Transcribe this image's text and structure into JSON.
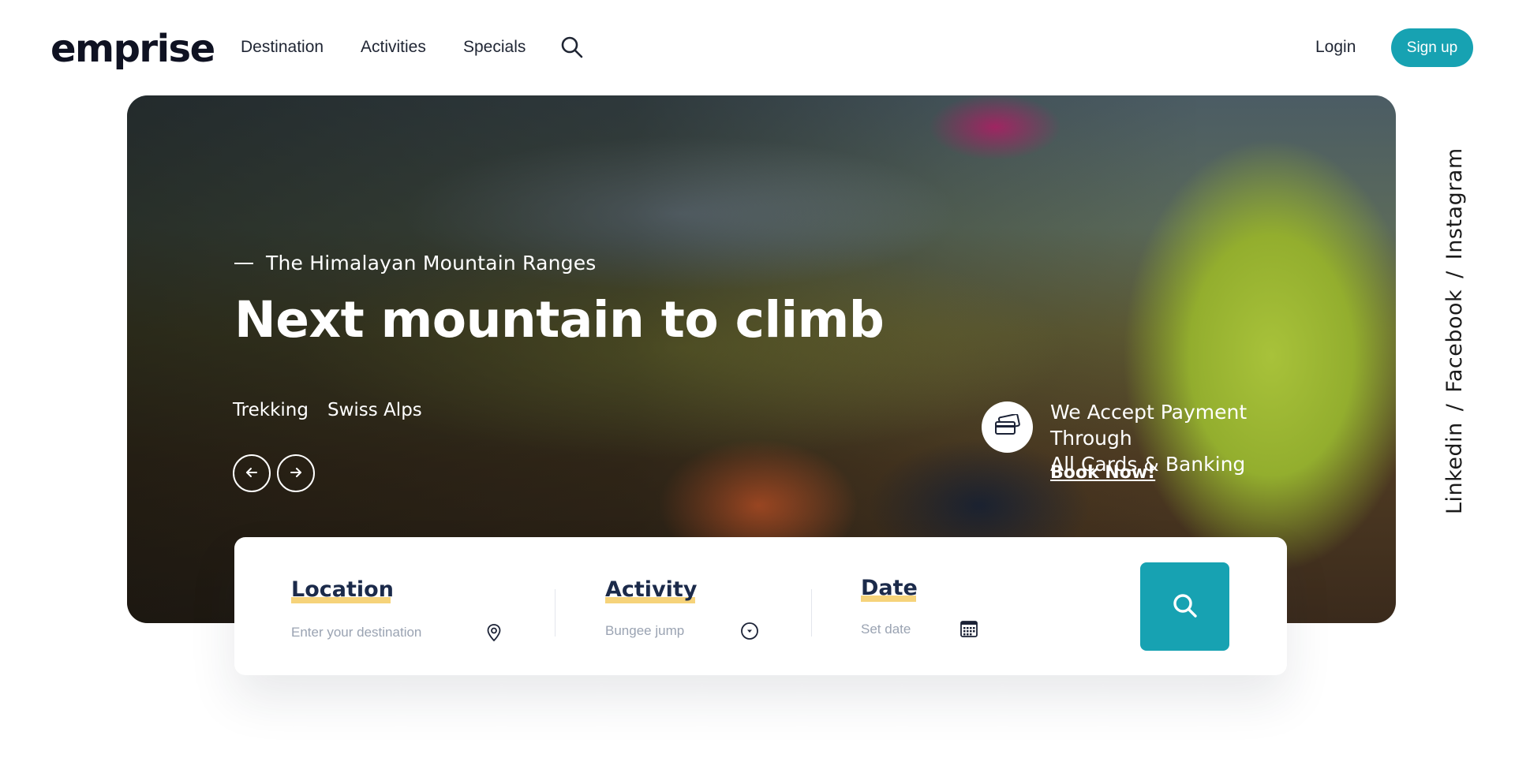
{
  "header": {
    "logo": "emprise",
    "nav": [
      "Destination",
      "Activities",
      "Specials"
    ],
    "search_icon": "search-icon",
    "login_label": "Login",
    "signup_label": "Sign up"
  },
  "hero": {
    "eyebrow": "The Himalayan Mountain Ranges",
    "title": "Next mountain to climb",
    "tags": [
      "Trekking",
      "Swiss Alps"
    ],
    "prev_icon": "arrow-left-icon",
    "next_icon": "arrow-right-icon",
    "payment_icon": "credit-card-icon",
    "payment_text_line1": "We Accept Payment Through",
    "payment_text_line2": "All Cards & Banking",
    "book_now_label": "Book Now!"
  },
  "search_card": {
    "location": {
      "label": "Location",
      "placeholder": "Enter your destination",
      "icon": "map-pin-icon"
    },
    "activity": {
      "label": "Activity",
      "placeholder": "Bungee jump",
      "icon": "dropdown-circle-icon"
    },
    "date": {
      "label": "Date",
      "placeholder": "Set date",
      "icon": "calendar-icon"
    },
    "submit_icon": "search-icon"
  },
  "social": {
    "links": [
      "Linkedin",
      "Facebook",
      "Instagram"
    ],
    "separator": "/"
  },
  "colors": {
    "accent": "#17a2b2",
    "highlight": "#f6d37a",
    "heading": "#1b2a4a"
  }
}
